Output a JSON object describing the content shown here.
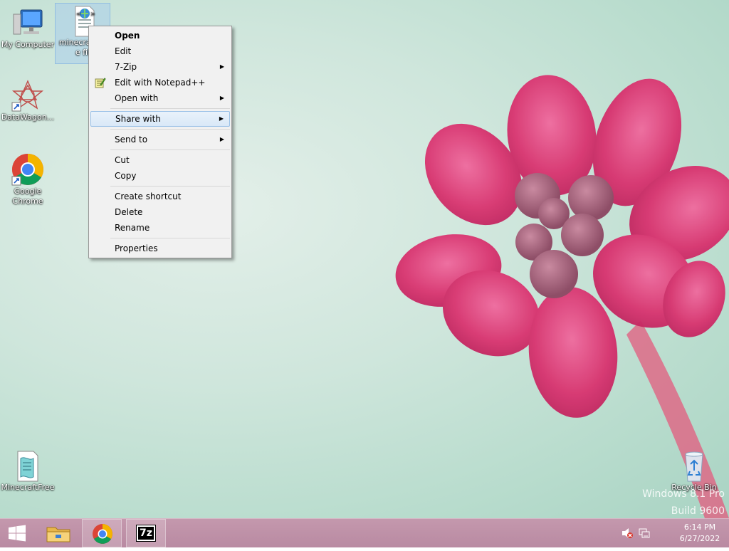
{
  "desktop": {
    "icons": [
      {
        "label": "My Computer"
      },
      {
        "label": "minecraft fil e fil"
      },
      {
        "label": "DataWagon..."
      },
      {
        "label": "Google Chrome"
      },
      {
        "label": "MinecraftFree"
      },
      {
        "label": "Recycle Bin"
      }
    ],
    "watermark": {
      "line1": "Windows 8.1 Pro",
      "line2": "Build 9600"
    }
  },
  "context_menu": {
    "items": [
      {
        "label": "Open",
        "bold": true
      },
      {
        "label": "Edit"
      },
      {
        "label": "7-Zip",
        "submenu": true
      },
      {
        "label": "Edit with Notepad++",
        "icon": "notepadpp-icon"
      },
      {
        "label": "Open with",
        "submenu": true
      },
      {
        "label": "Share with",
        "submenu": true,
        "highlighted": true
      },
      {
        "label": "Send to",
        "submenu": true
      },
      {
        "label": "Cut"
      },
      {
        "label": "Copy"
      },
      {
        "label": "Create shortcut"
      },
      {
        "label": "Delete"
      },
      {
        "label": "Rename"
      },
      {
        "label": "Properties"
      }
    ]
  },
  "taskbar": {
    "buttons": [
      {
        "name": "start-button",
        "icon": "windows-logo-icon"
      },
      {
        "name": "file-explorer-button",
        "icon": "folder-icon"
      },
      {
        "name": "chrome-button",
        "icon": "chrome-icon"
      },
      {
        "name": "7zip-button",
        "icon": "7zip-icon",
        "text": "7z"
      }
    ],
    "tray": {
      "volume_icon": "volume-muted-icon",
      "network_icon": "network-icon"
    },
    "clock": {
      "time": "6:14 PM",
      "date": "6/27/2022"
    }
  },
  "colors": {
    "taskbar": "#b98aa2",
    "menu_highlight": "#d9e8f7",
    "flower": "#e0407a"
  }
}
